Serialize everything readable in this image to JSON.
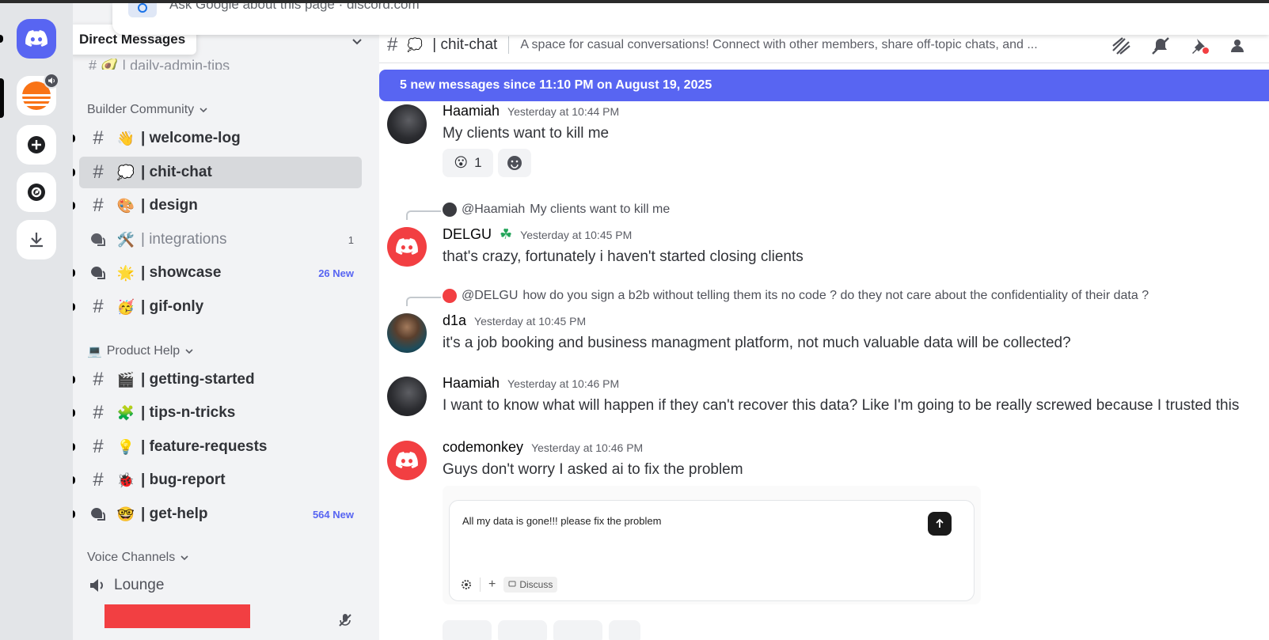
{
  "browser_strip": {
    "text": "Ask Google about this page · discord.com"
  },
  "tooltip": {
    "label": "Direct Messages"
  },
  "sidebar": {
    "cut_channel": "# 🥑 | daily-admin-tips",
    "categories": [
      {
        "label": "Builder Community"
      },
      {
        "label": "Product Help"
      },
      {
        "label": "Voice Channels"
      }
    ],
    "channels": [
      {
        "emoji": "👋",
        "name": "| welcome-log",
        "badge": ""
      },
      {
        "emoji": "💭",
        "name": "| chit-chat",
        "badge": ""
      },
      {
        "emoji": "🎨",
        "name": "| design",
        "badge": ""
      },
      {
        "emoji": "🛠️",
        "name": "| integrations",
        "badge": "1"
      },
      {
        "emoji": "🌟",
        "name": "| showcase",
        "badge": "26 New"
      },
      {
        "emoji": "🥳",
        "name": "| gif-only",
        "badge": ""
      },
      {
        "emoji": "🎬",
        "name": "| getting-started",
        "badge": ""
      },
      {
        "emoji": "🧩",
        "name": "| tips-n-tricks",
        "badge": ""
      },
      {
        "emoji": "💡",
        "name": "| feature-requests",
        "badge": ""
      },
      {
        "emoji": "🐞",
        "name": "| bug-report",
        "badge": ""
      },
      {
        "emoji": "🤓",
        "name": "| get-help",
        "badge": "564 New"
      }
    ],
    "voice": {
      "label": "Lounge"
    }
  },
  "topbar": {
    "hash": "#",
    "emoji": "💭",
    "title": "| chit-chat",
    "topic": "A space for casual conversations! Connect with other members, share off-topic chats, and ..."
  },
  "new_messages_bar": "5 new messages since 11:10 PM on August 19, 2025",
  "messages": [
    {
      "author": "Haamiah",
      "time": "Yesterday at 10:44 PM",
      "text": "My clients want to kill me",
      "reactions": [
        {
          "emoji": "😮",
          "count": "1"
        }
      ]
    },
    {
      "reply_to": "@Haamiah",
      "reply_text": "My clients want to kill me",
      "author": "DELGU",
      "author_badge": "☘",
      "time": "Yesterday at 10:45 PM",
      "text": "that's crazy, fortunately i haven't started closing clients"
    },
    {
      "reply_to": "@DELGU",
      "reply_text": "how do you sign a b2b without telling them its no code ? do they not care about the confidentiality of their data ?",
      "author": "d1a",
      "time": "Yesterday at 10:45 PM",
      "text": "it's a job booking and business managment platform, not much valuable data will be collected?"
    },
    {
      "author": "Haamiah",
      "time": "Yesterday at 10:46 PM",
      "text": "I want to know what will happen if they can't recover this data? Like I'm going to be really screwed because I trusted this"
    },
    {
      "author": "codemonkey",
      "time": "Yesterday at 10:46 PM",
      "text": "Guys don't worry I asked ai to fix the problem",
      "embed": {
        "prompt_text": "All my data is gone!!! please fix the problem",
        "discuss_label": "Discuss"
      }
    }
  ],
  "colors": {
    "blurple": "#5865f2",
    "red": "#f23f42",
    "sidebar_bg": "#f2f3f5",
    "rail_bg": "#e3e5e8"
  }
}
